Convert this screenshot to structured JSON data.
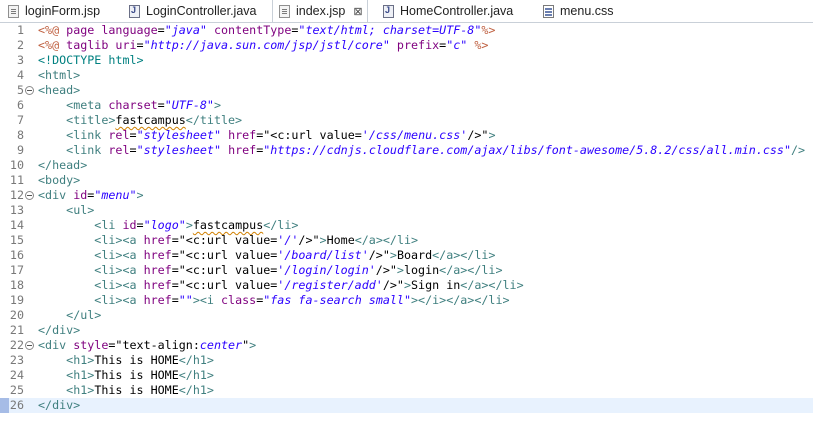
{
  "tabs": [
    {
      "label": "loginForm.jsp",
      "type": "jsp",
      "active": false
    },
    {
      "label": "LoginController.java",
      "type": "java",
      "active": false
    },
    {
      "label": "index.jsp",
      "type": "jsp",
      "active": true,
      "close": "⊠"
    },
    {
      "label": "HomeController.java",
      "type": "java",
      "active": false
    },
    {
      "label": "menu.css",
      "type": "css",
      "active": false
    }
  ],
  "colors": {
    "tag": "#3f7f7f",
    "attr": "#7f007f",
    "string": "#2a00ff",
    "jsp": "#bf5f3f",
    "current_line": "#e8f2fe"
  },
  "editor": {
    "current_line": 26,
    "lines": [
      [
        [
          "jsp",
          "<%@ "
        ],
        [
          "attr",
          "page "
        ],
        [
          "attr",
          "language"
        ],
        [
          "txt",
          "="
        ],
        [
          "str",
          "\"java\""
        ],
        [
          "txt",
          " "
        ],
        [
          "attr",
          "contentType"
        ],
        [
          "txt",
          "="
        ],
        [
          "str",
          "\"text/html; charset=UTF-8\""
        ],
        [
          "jsp",
          "%>"
        ]
      ],
      [
        [
          "jsp",
          "<%@ "
        ],
        [
          "attr",
          "taglib "
        ],
        [
          "attr",
          "uri"
        ],
        [
          "txt",
          "="
        ],
        [
          "str",
          "\"http://java.sun.com/jsp/jstl/core\""
        ],
        [
          "txt",
          " "
        ],
        [
          "attr",
          "prefix"
        ],
        [
          "txt",
          "="
        ],
        [
          "str",
          "\"c\""
        ],
        [
          "txt",
          " "
        ],
        [
          "jsp",
          "%>"
        ]
      ],
      [
        [
          "dt",
          "<!DOCTYPE html>"
        ]
      ],
      [
        [
          "tag",
          "<html>"
        ]
      ],
      [
        [
          "tag",
          "<head>"
        ]
      ],
      [
        [
          "txt",
          "    "
        ],
        [
          "tag",
          "<meta "
        ],
        [
          "attr",
          "charset"
        ],
        [
          "txt",
          "="
        ],
        [
          "str",
          "\"UTF-8\""
        ],
        [
          "tag",
          ">"
        ]
      ],
      [
        [
          "txt",
          "    "
        ],
        [
          "tag",
          "<title>"
        ],
        [
          "sq",
          "fastcampus"
        ],
        [
          "tag",
          "</title>"
        ]
      ],
      [
        [
          "txt",
          "    "
        ],
        [
          "tag",
          "<link "
        ],
        [
          "attr",
          "rel"
        ],
        [
          "txt",
          "="
        ],
        [
          "str",
          "\"stylesheet\""
        ],
        [
          "txt",
          " "
        ],
        [
          "attr",
          "href"
        ],
        [
          "txt",
          "="
        ],
        [
          "txt",
          "\"<c:url value="
        ],
        [
          "str",
          "'/css/menu.css'"
        ],
        [
          "txt",
          "/>\""
        ],
        [
          "tag",
          ">"
        ]
      ],
      [
        [
          "txt",
          "    "
        ],
        [
          "tag",
          "<link "
        ],
        [
          "attr",
          "rel"
        ],
        [
          "txt",
          "="
        ],
        [
          "str",
          "\"stylesheet\""
        ],
        [
          "txt",
          " "
        ],
        [
          "attr",
          "href"
        ],
        [
          "txt",
          "="
        ],
        [
          "str",
          "\"https://cdnjs.cloudflare.com/ajax/libs/font-awesome/5.8.2/css/all.min.css\""
        ],
        [
          "tag",
          "/>"
        ]
      ],
      [
        [
          "tag",
          "</head>"
        ]
      ],
      [
        [
          "tag",
          "<body>"
        ]
      ],
      [
        [
          "tag",
          "<div "
        ],
        [
          "attr",
          "id"
        ],
        [
          "txt",
          "="
        ],
        [
          "str",
          "\"menu\""
        ],
        [
          "tag",
          ">"
        ]
      ],
      [
        [
          "txt",
          "    "
        ],
        [
          "tag",
          "<ul>"
        ]
      ],
      [
        [
          "txt",
          "        "
        ],
        [
          "tag",
          "<li "
        ],
        [
          "attr",
          "id"
        ],
        [
          "txt",
          "="
        ],
        [
          "str",
          "\"logo\""
        ],
        [
          "tag",
          ">"
        ],
        [
          "sq",
          "fastcampus"
        ],
        [
          "tag",
          "</li>"
        ]
      ],
      [
        [
          "txt",
          "        "
        ],
        [
          "tag",
          "<li><a "
        ],
        [
          "attr",
          "href"
        ],
        [
          "txt",
          "="
        ],
        [
          "txt",
          "\"<c:url value="
        ],
        [
          "str",
          "'/'"
        ],
        [
          "txt",
          "/>\""
        ],
        [
          "tag",
          ">"
        ],
        [
          "txt",
          "Home"
        ],
        [
          "tag",
          "</a></li>"
        ]
      ],
      [
        [
          "txt",
          "        "
        ],
        [
          "tag",
          "<li><a "
        ],
        [
          "attr",
          "href"
        ],
        [
          "txt",
          "="
        ],
        [
          "txt",
          "\"<c:url value="
        ],
        [
          "str",
          "'/board/list'"
        ],
        [
          "txt",
          "/>\""
        ],
        [
          "tag",
          ">"
        ],
        [
          "txt",
          "Board"
        ],
        [
          "tag",
          "</a></li>"
        ]
      ],
      [
        [
          "txt",
          "        "
        ],
        [
          "tag",
          "<li><a "
        ],
        [
          "attr",
          "href"
        ],
        [
          "txt",
          "="
        ],
        [
          "txt",
          "\"<c:url value="
        ],
        [
          "str",
          "'/login/login'"
        ],
        [
          "txt",
          "/>\""
        ],
        [
          "tag",
          ">"
        ],
        [
          "txt",
          "login"
        ],
        [
          "tag",
          "</a></li>"
        ]
      ],
      [
        [
          "txt",
          "        "
        ],
        [
          "tag",
          "<li><a "
        ],
        [
          "attr",
          "href"
        ],
        [
          "txt",
          "="
        ],
        [
          "txt",
          "\"<c:url value="
        ],
        [
          "str",
          "'/register/add'"
        ],
        [
          "txt",
          "/>\""
        ],
        [
          "tag",
          ">"
        ],
        [
          "txt",
          "Sign in"
        ],
        [
          "tag",
          "</a></li>"
        ]
      ],
      [
        [
          "txt",
          "        "
        ],
        [
          "tag",
          "<li><a "
        ],
        [
          "attr",
          "href"
        ],
        [
          "txt",
          "="
        ],
        [
          "str",
          "\"\""
        ],
        [
          "tag",
          "><i "
        ],
        [
          "attr",
          "class"
        ],
        [
          "txt",
          "="
        ],
        [
          "str",
          "\"fas fa-search small\""
        ],
        [
          "tag",
          "></i></a></li>"
        ]
      ],
      [
        [
          "txt",
          "    "
        ],
        [
          "tag",
          "</ul>"
        ]
      ],
      [
        [
          "tag",
          "</div>"
        ]
      ],
      [
        [
          "tag",
          "<div "
        ],
        [
          "attr",
          "style"
        ],
        [
          "txt",
          "="
        ],
        [
          "txt",
          "\"text-align:"
        ],
        [
          "str",
          "center"
        ],
        [
          "txt",
          "\""
        ],
        [
          "tag",
          ">"
        ]
      ],
      [
        [
          "txt",
          "    "
        ],
        [
          "tag",
          "<h1>"
        ],
        [
          "txt",
          "This is HOME"
        ],
        [
          "tag",
          "</h1>"
        ]
      ],
      [
        [
          "txt",
          "    "
        ],
        [
          "tag",
          "<h1>"
        ],
        [
          "txt",
          "This is HOME"
        ],
        [
          "tag",
          "</h1>"
        ]
      ],
      [
        [
          "txt",
          "    "
        ],
        [
          "tag",
          "<h1>"
        ],
        [
          "txt",
          "This is HOME"
        ],
        [
          "tag",
          "</h1>"
        ]
      ],
      [
        [
          "tag",
          "</div>"
        ]
      ]
    ],
    "fold_lines": [
      5,
      12,
      22
    ]
  }
}
